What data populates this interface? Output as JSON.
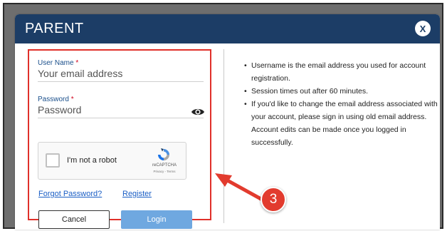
{
  "dialog": {
    "title": "PARENT",
    "close_label": "X"
  },
  "form": {
    "username": {
      "label": "User Name",
      "required_mark": "*",
      "placeholder": "Your email address"
    },
    "password": {
      "label": "Password",
      "required_mark": "*",
      "placeholder": "Password"
    },
    "recaptcha": {
      "label": "I'm not a robot",
      "brand": "reCAPTCHA",
      "terms": "Privacy - Terms"
    },
    "links": {
      "forgot": "Forgot Password?",
      "register": "Register"
    },
    "buttons": {
      "cancel": "Cancel",
      "login": "Login"
    }
  },
  "info": {
    "items": [
      "Username is the email address you used for account registration.",
      "Session times out after 60 minutes.",
      "If you'd like to change the email address associated with your account, please sign in using old email address. Account edits can be made once you logged in successfully."
    ]
  },
  "annotation": {
    "number": "3"
  },
  "colors": {
    "header": "#1c3d66",
    "highlight_border": "#e0302a",
    "login_button": "#6fa8e0",
    "link": "#1a5ec5",
    "annotation": "#e23b2e"
  }
}
